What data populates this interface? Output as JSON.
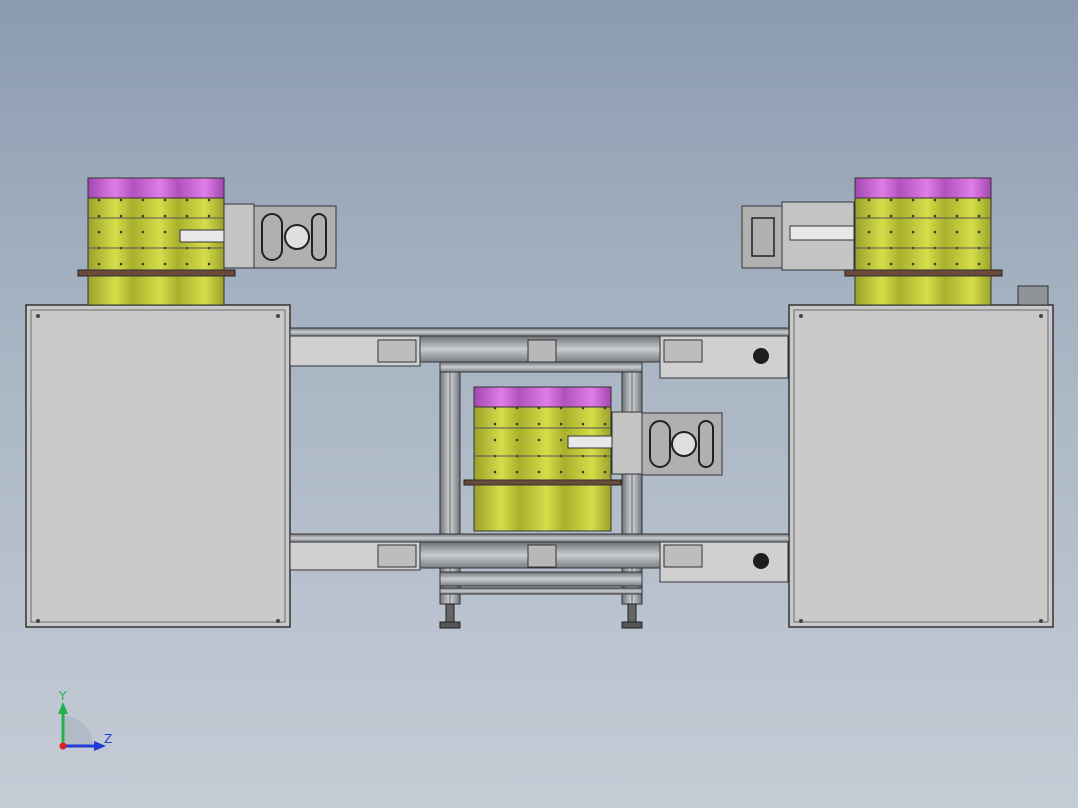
{
  "scene": {
    "view": "front",
    "background": [
      "#8b9bb0",
      "#c5ccd6"
    ]
  },
  "triad": {
    "y_label": "Y",
    "z_label": "Z",
    "y_color": "#22b14c",
    "z_color": "#1f3bd6",
    "origin_color": "#d81e1e"
  },
  "colors": {
    "cabinet": "#c8c8c8",
    "frame": "#b9b9b9",
    "bowl_top": "#c75fd0",
    "bowl_body": "#c9d233",
    "steel": "#8a8a8a",
    "dark": "#2a2a2a"
  }
}
